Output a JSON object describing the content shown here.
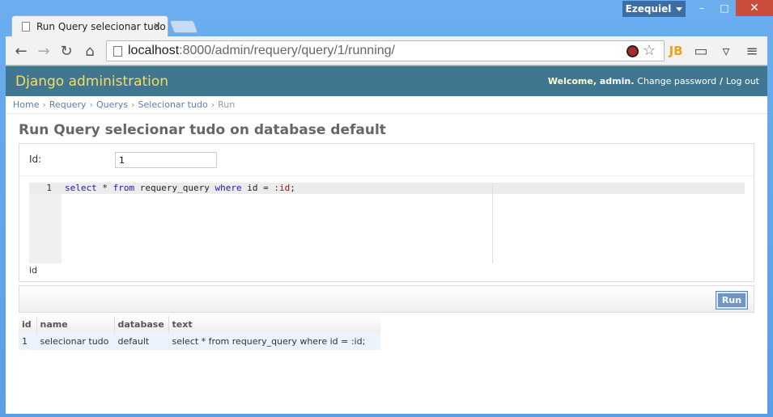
{
  "window": {
    "user_label": "Ezequiel",
    "minimize": "–",
    "maximize": "□",
    "close": "✕"
  },
  "tab": {
    "title": "Run Query selecionar tudo",
    "close": "×"
  },
  "toolbar": {
    "back": "←",
    "forward": "→",
    "reload": "↻",
    "home": "⌂",
    "url_host": "localhost",
    "url_path": ":8000/admin/requery/query/1/running/",
    "ext_jb": "JB",
    "cast": "▭",
    "pocket": "▿",
    "menu": "≡",
    "star": "☆"
  },
  "header": {
    "brand": "Django administration",
    "welcome": "Welcome,",
    "user": "admin",
    "change_password": "Change password",
    "sep": "/",
    "logout": "Log out"
  },
  "breadcrumbs": {
    "items": [
      "Home",
      "Requery",
      "Querys",
      "Selecionar tudo"
    ],
    "current": "Run",
    "sep": "›"
  },
  "title": "Run Query selecionar tudo on database default",
  "form": {
    "id_label": "Id:",
    "id_value": "1",
    "line_number": "1",
    "code": {
      "t1": "select",
      "t2": " * ",
      "t3": "from",
      "t4": " requery_query ",
      "t5": "where",
      "t6": " id = ",
      "t7": ":id",
      "t8": ";"
    },
    "param_label": "id"
  },
  "run_button": "Run",
  "results": {
    "columns": [
      "id",
      "name",
      "database",
      "text"
    ],
    "rows": [
      [
        "1",
        "selecionar tudo",
        "default",
        "select * from requery_query where id = :id;"
      ]
    ]
  }
}
